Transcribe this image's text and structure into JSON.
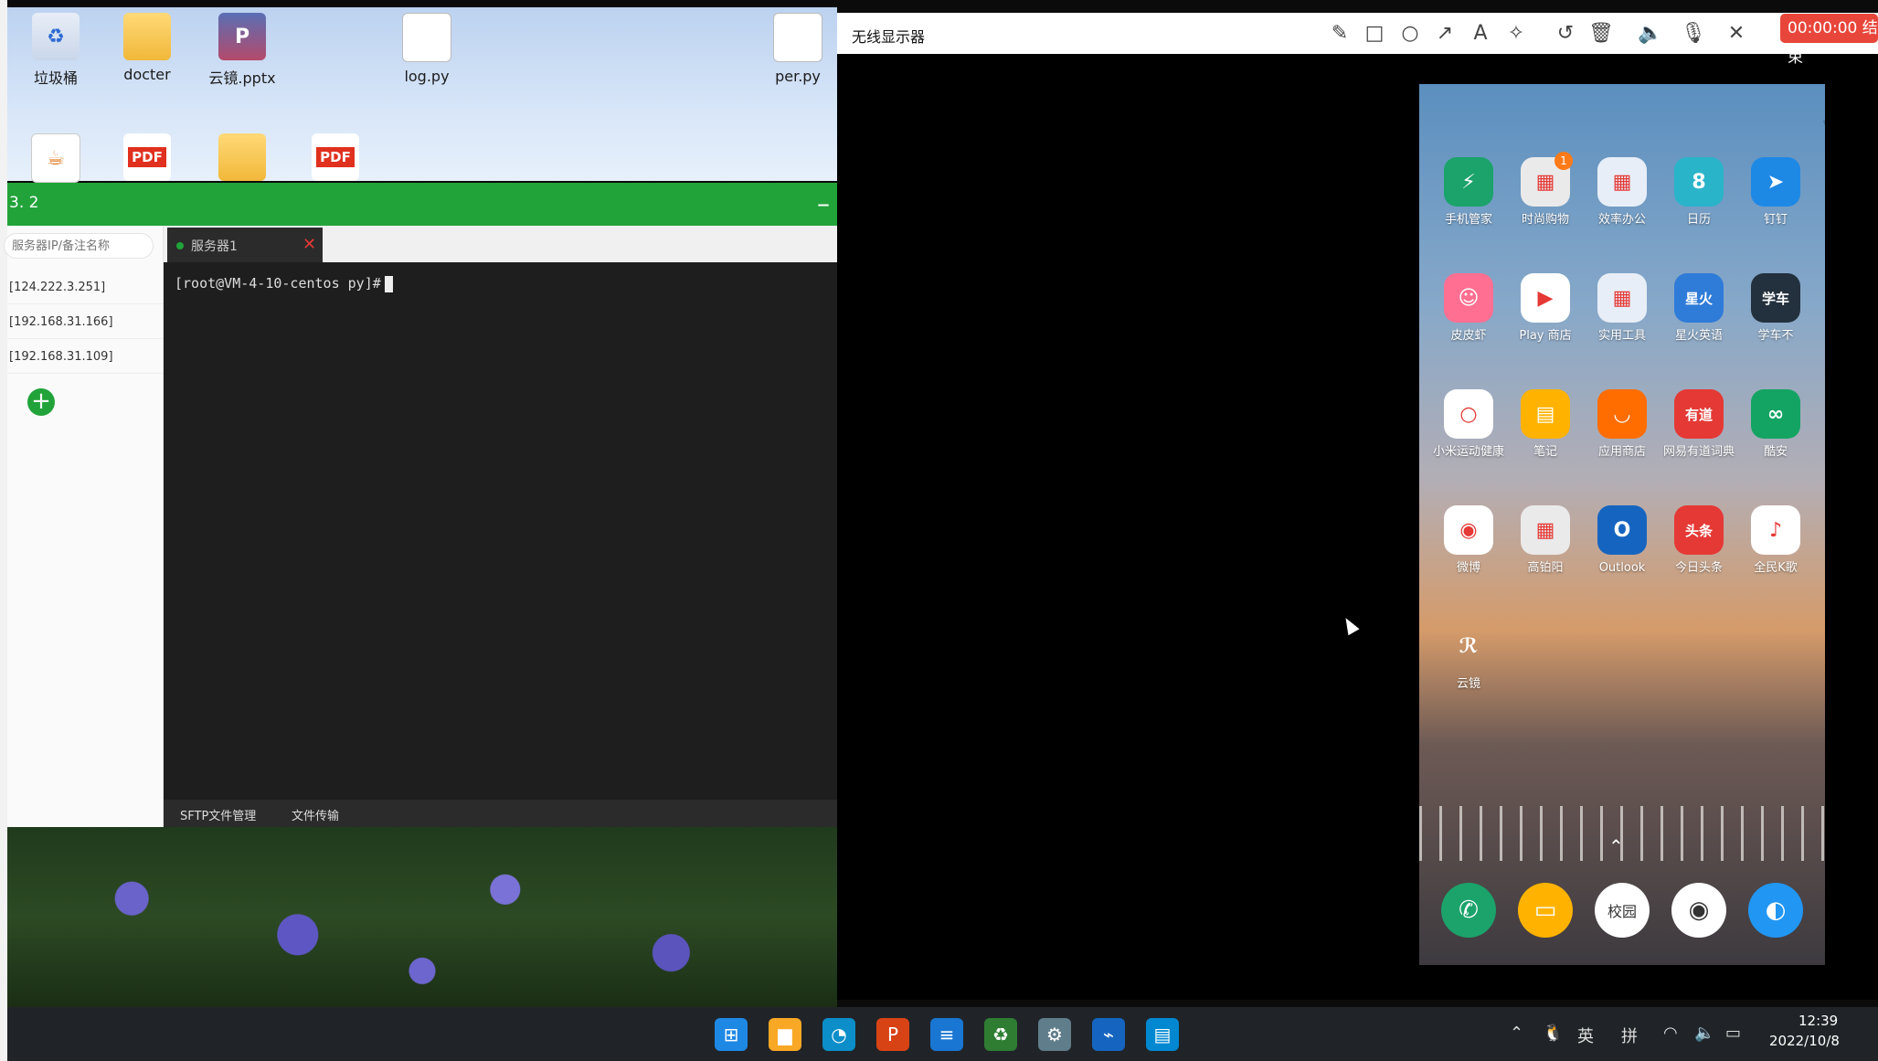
{
  "desktop": {
    "icons_top": [
      {
        "label": "垃圾桶",
        "icon": "recycle-bin-icon"
      },
      {
        "label": "docter",
        "icon": "folder-icon"
      },
      {
        "label": "云镜.pptx",
        "icon": "pptx-icon"
      },
      {
        "label": "log.py",
        "icon": "file-icon"
      },
      {
        "label": "per.py",
        "icon": "file-icon"
      }
    ],
    "icons_row2": [
      {
        "label": "",
        "icon": "java-icon"
      },
      {
        "label": "PDF",
        "icon": "pdf-icon"
      },
      {
        "label": "",
        "icon": "folder-icon"
      },
      {
        "label": "PDF",
        "icon": "pdf-icon"
      }
    ]
  },
  "ssh": {
    "title": "3. 2",
    "min": "–",
    "close": "✕",
    "search_placeholder": "服务器IP/备注名称",
    "servers": [
      "[124.222.3.251]",
      "[192.168.31.166]",
      "[192.168.31.109]"
    ],
    "add": "+",
    "tab_label": "服务器1",
    "tab_close": "✕",
    "prompt": "[root@VM-4-10-centos py]#",
    "bottom_tabs": [
      "SFTP文件管理",
      "文件传输"
    ]
  },
  "wireless": {
    "title": "无线显示器",
    "tools": [
      "✎",
      "□",
      "○",
      "↗",
      "A",
      "✧",
      "↺",
      "🗑",
      "🔈",
      "🎙",
      "✕"
    ],
    "record_label": "00:00:00 结束"
  },
  "phone": {
    "apps": [
      {
        "name": "手机管家",
        "color": "#1ba36b",
        "glyph": "⚡"
      },
      {
        "name": "时尚购物",
        "color": "#eaeaea",
        "glyph": "▦"
      },
      {
        "name": "效率办公",
        "color": "#e8eef7",
        "glyph": "▦"
      },
      {
        "name": "日历",
        "color": "#2ab4c9",
        "glyph": "8"
      },
      {
        "name": "钉钉",
        "color": "#1e88e5",
        "glyph": "➤"
      },
      {
        "name": "皮皮虾",
        "color": "#ff6f91",
        "glyph": "☺"
      },
      {
        "name": "Play 商店",
        "color": "#ffffff",
        "glyph": "▶"
      },
      {
        "name": "实用工具",
        "color": "#e8eef7",
        "glyph": "▦"
      },
      {
        "name": "星火英语",
        "color": "#2f7bd8",
        "glyph": "星火"
      },
      {
        "name": "学车不",
        "color": "#23303d",
        "glyph": "学车"
      },
      {
        "name": "小米运动健康",
        "color": "#ffffff",
        "glyph": "○"
      },
      {
        "name": "笔记",
        "color": "#ffb300",
        "glyph": "▤"
      },
      {
        "name": "应用商店",
        "color": "#ff6d00",
        "glyph": "◡"
      },
      {
        "name": "网易有道词典",
        "color": "#e53935",
        "glyph": "有道"
      },
      {
        "name": "酷安",
        "color": "#13a463",
        "glyph": "∞"
      },
      {
        "name": "微博",
        "color": "#ffffff",
        "glyph": "◉"
      },
      {
        "name": "高铂阳",
        "color": "#eaeaea",
        "glyph": "▦"
      },
      {
        "name": "Outlook",
        "color": "#1565c0",
        "glyph": "O"
      },
      {
        "name": "今日头条",
        "color": "#e53935",
        "glyph": "头条"
      },
      {
        "name": "全民K歌",
        "color": "#ffffff",
        "glyph": "♪"
      },
      {
        "name": "云镜",
        "color": "transparent",
        "glyph": "ℛ"
      }
    ],
    "badge": "1",
    "swipe": "⌃",
    "dock": [
      {
        "name": "phone-app",
        "color": "#1ba36b",
        "glyph": "✆"
      },
      {
        "name": "messages-app",
        "color": "#ffb300",
        "glyph": "▭"
      },
      {
        "name": "campus-app",
        "color": "#ffffff",
        "glyph": "校园"
      },
      {
        "name": "camera-app",
        "color": "#ffffff",
        "glyph": "◉"
      },
      {
        "name": "browser-app",
        "color": "#2196f3",
        "glyph": "◐"
      }
    ]
  },
  "taskbar": {
    "apps": [
      {
        "name": "start",
        "color": "#1e88e5",
        "glyph": "⊞"
      },
      {
        "name": "file-explorer",
        "color": "#f9a825",
        "glyph": "▆"
      },
      {
        "name": "edge",
        "color": "#0b8ec9",
        "glyph": "◔"
      },
      {
        "name": "powerpoint",
        "color": "#d84315",
        "glyph": "P"
      },
      {
        "name": "notepad",
        "color": "#1976d2",
        "glyph": "≡"
      },
      {
        "name": "ssh-client",
        "color": "#2e7d32",
        "glyph": "♻"
      },
      {
        "name": "settings",
        "color": "#607d8b",
        "glyph": "⚙"
      },
      {
        "name": "wireless-display",
        "color": "#1565c0",
        "glyph": "⌁"
      },
      {
        "name": "browser",
        "color": "#0288d1",
        "glyph": "▤"
      }
    ],
    "tray": [
      "⌃",
      "🐧",
      "英",
      "拼",
      "◠",
      "🔈",
      "▭"
    ],
    "time": "12:39",
    "date": "2022/10/8"
  }
}
